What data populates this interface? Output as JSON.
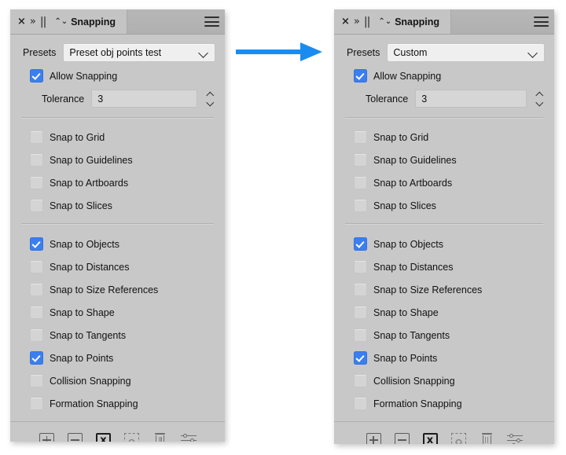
{
  "colors": {
    "accent_checkbox": "#3b7ef0",
    "arrow": "#1a8cf0",
    "panel_bg": "#c8c8c8",
    "titlebar_bg": "#b5b5b5",
    "field_bg": "#efefef"
  },
  "titlebar": {
    "close_icon": "×",
    "collapse_icon": "»",
    "grip_icon": "||",
    "sort_icon": "⌃⌄",
    "tab_label": "Snapping",
    "menu_icon": "hamburger-menu"
  },
  "panels": [
    {
      "id": "before",
      "presets": {
        "label": "Presets",
        "value": "Preset obj points test",
        "chevron_icon": "chevron-down"
      },
      "allow_snapping": {
        "label": "Allow Snapping",
        "checked": true
      },
      "tolerance": {
        "label": "Tolerance",
        "value": "3",
        "stepper_icon": "up-down-chevron"
      },
      "group_one": [
        {
          "label": "Snap to Grid",
          "checked": false
        },
        {
          "label": "Snap to Guidelines",
          "checked": false
        },
        {
          "label": "Snap to Artboards",
          "checked": false
        },
        {
          "label": "Snap to Slices",
          "checked": false
        }
      ],
      "group_two": [
        {
          "label": "Snap to Objects",
          "checked": true
        },
        {
          "label": "Snap to Distances",
          "checked": false
        },
        {
          "label": "Snap to Size References",
          "checked": false
        },
        {
          "label": "Snap to Shape",
          "checked": false
        },
        {
          "label": "Snap to Tangents",
          "checked": false
        },
        {
          "label": "Snap to Points",
          "checked": true
        },
        {
          "label": "Collision Snapping",
          "checked": false
        },
        {
          "label": "Formation Snapping",
          "checked": false
        }
      ],
      "footer": [
        {
          "name": "add-preset",
          "icon": "plus-in-box",
          "active": false
        },
        {
          "name": "remove-preset",
          "icon": "minus-in-box",
          "active": false
        },
        {
          "name": "clear-preset",
          "icon": "x-in-box",
          "active": true
        },
        {
          "name": "magnet-selection",
          "icon": "magnet-dashed-box",
          "active": false
        },
        {
          "name": "delete",
          "icon": "trash-can",
          "active": false
        },
        {
          "name": "settings",
          "icon": "sliders",
          "active": false
        }
      ]
    },
    {
      "id": "after",
      "presets": {
        "label": "Presets",
        "value": "Custom",
        "chevron_icon": "chevron-down"
      },
      "allow_snapping": {
        "label": "Allow Snapping",
        "checked": true
      },
      "tolerance": {
        "label": "Tolerance",
        "value": "3",
        "stepper_icon": "up-down-chevron"
      },
      "group_one": [
        {
          "label": "Snap to Grid",
          "checked": false
        },
        {
          "label": "Snap to Guidelines",
          "checked": false
        },
        {
          "label": "Snap to Artboards",
          "checked": false
        },
        {
          "label": "Snap to Slices",
          "checked": false
        }
      ],
      "group_two": [
        {
          "label": "Snap to Objects",
          "checked": true
        },
        {
          "label": "Snap to Distances",
          "checked": false
        },
        {
          "label": "Snap to Size References",
          "checked": false
        },
        {
          "label": "Snap to Shape",
          "checked": false
        },
        {
          "label": "Snap to Tangents",
          "checked": false
        },
        {
          "label": "Snap to Points",
          "checked": true
        },
        {
          "label": "Collision Snapping",
          "checked": false
        },
        {
          "label": "Formation Snapping",
          "checked": false
        }
      ],
      "footer": [
        {
          "name": "add-preset",
          "icon": "plus-in-box",
          "active": false
        },
        {
          "name": "remove-preset",
          "icon": "minus-in-box",
          "active": false
        },
        {
          "name": "clear-preset",
          "icon": "x-in-box",
          "active": true
        },
        {
          "name": "magnet-selection",
          "icon": "magnet-dashed-box",
          "active": false
        },
        {
          "name": "delete",
          "icon": "trash-can",
          "active": false
        },
        {
          "name": "settings",
          "icon": "sliders",
          "active": false
        }
      ]
    }
  ],
  "arrow": {
    "name": "transition-arrow",
    "direction": "right"
  }
}
